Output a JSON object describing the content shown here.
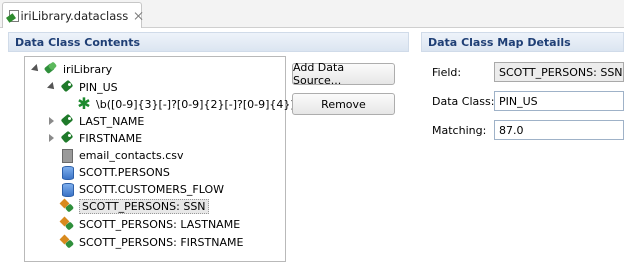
{
  "tab": {
    "title": "iriLibrary.dataclass"
  },
  "left_panel": {
    "title": "Data Class Contents",
    "tree": [
      {
        "label": "iriLibrary",
        "icon": "tags-multi-icon",
        "state": "expanded"
      },
      {
        "label": "PIN_US",
        "icon": "tag-icon",
        "state": "expanded"
      },
      {
        "label": "\\b([0-9]{3}[-]?[0-9]{2}[-]?[0-9]{4})\\b",
        "icon": "asterisk-icon"
      },
      {
        "label": "LAST_NAME",
        "icon": "tag-icon",
        "state": "collapsed"
      },
      {
        "label": "FIRSTNAME",
        "icon": "tag-icon",
        "state": "collapsed"
      },
      {
        "label": "email_contacts.csv",
        "icon": "file-icon"
      },
      {
        "label": "SCOTT.PERSONS",
        "icon": "database-icon"
      },
      {
        "label": "SCOTT.CUSTOMERS_FLOW",
        "icon": "database-icon"
      },
      {
        "label": "SCOTT_PERSONS: SSN",
        "icon": "mapping-icon",
        "selected": true
      },
      {
        "label": "SCOTT_PERSONS: LASTNAME",
        "icon": "mapping-icon"
      },
      {
        "label": "SCOTT_PERSONS: FIRSTNAME",
        "icon": "mapping-icon"
      }
    ],
    "buttons": {
      "add_data_source": "Add Data Source...",
      "remove": "Remove"
    }
  },
  "right_panel": {
    "title": "Data Class Map Details",
    "field": {
      "label": "Field:",
      "value": "SCOTT_PERSONS: SSN"
    },
    "data_class": {
      "label": "Data Class:",
      "value": "PIN_US"
    },
    "matching": {
      "label": "Matching:",
      "value": "87.0"
    }
  }
}
